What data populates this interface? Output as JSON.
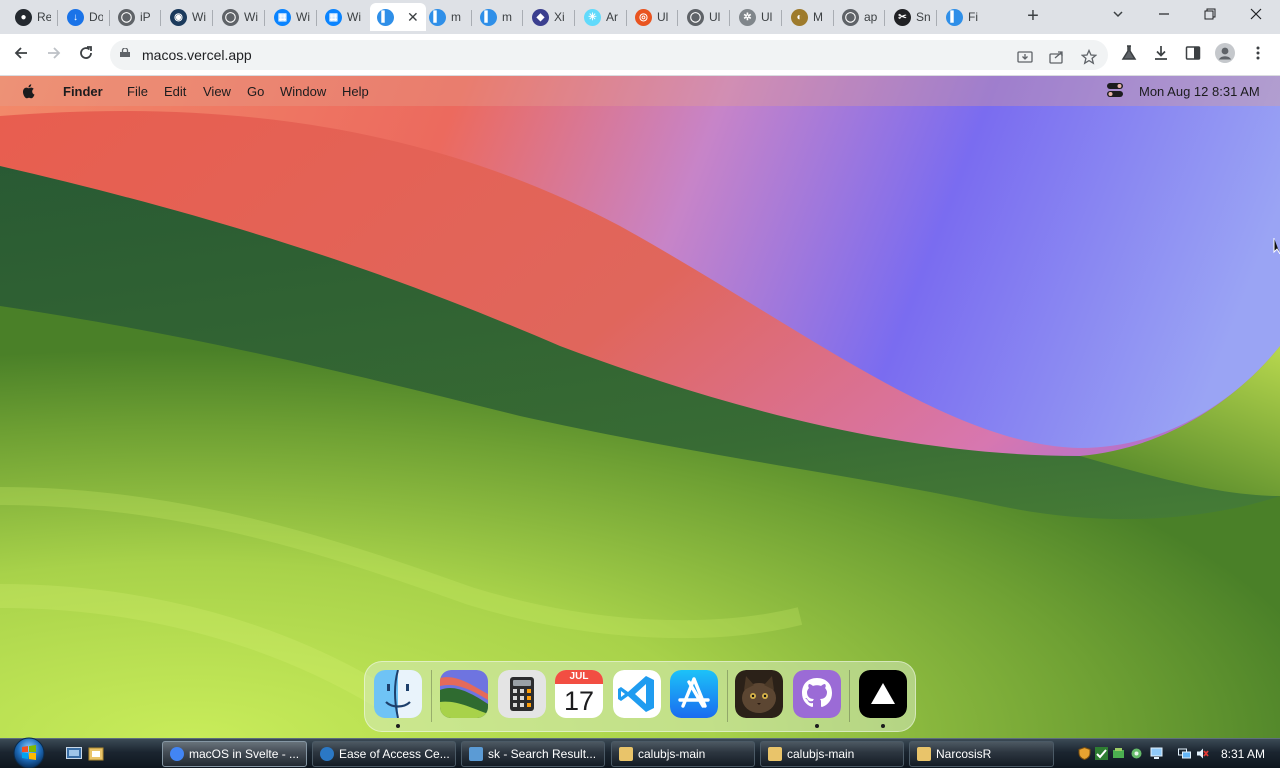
{
  "browser": {
    "tabs": [
      {
        "icon": "github-icon",
        "title": "Re"
      },
      {
        "icon": "download-icon",
        "title": "Do"
      },
      {
        "icon": "globe-icon",
        "title": "iP"
      },
      {
        "icon": "ai-app-icon",
        "title": "Wi"
      },
      {
        "icon": "globe-icon",
        "title": "Wi"
      },
      {
        "icon": "windows-logo-icon",
        "title": "Wi"
      },
      {
        "icon": "windows-logo-icon",
        "title": "Wi"
      },
      {
        "icon": "finder-icon",
        "title": "",
        "active": true
      },
      {
        "icon": "finder-icon",
        "title": "m"
      },
      {
        "icon": "finder-icon",
        "title": "m"
      },
      {
        "icon": "xi-icon",
        "title": "Xi"
      },
      {
        "icon": "react-icon",
        "title": "Ar"
      },
      {
        "icon": "ubuntu-icon",
        "title": "Ul"
      },
      {
        "icon": "globe-icon",
        "title": "Ul"
      },
      {
        "icon": "settings-icon",
        "title": "Ul"
      },
      {
        "icon": "m-app-icon",
        "title": "M"
      },
      {
        "icon": "globe-icon",
        "title": "ap"
      },
      {
        "icon": "snip-icon",
        "title": "Sn"
      },
      {
        "icon": "finder-icon",
        "title": "Fi"
      }
    ],
    "url": "macos.vercel.app"
  },
  "mac": {
    "app_name": "Finder",
    "menus": [
      "File",
      "Edit",
      "View",
      "Go",
      "Window",
      "Help"
    ],
    "clock": "Mon Aug 12  8:31 AM",
    "dock": {
      "apps": [
        {
          "name": "finder",
          "running": true
        },
        {
          "name": "wallpapers",
          "running": false
        },
        {
          "name": "calculator",
          "running": false
        },
        {
          "name": "calendar",
          "running": false
        },
        {
          "name": "vscode",
          "running": false
        },
        {
          "name": "app-store",
          "running": false
        },
        {
          "name": "purrfect-cat",
          "running": false
        },
        {
          "name": "github",
          "running": true
        },
        {
          "name": "vercel",
          "running": true
        }
      ],
      "calendar_month": "JUL",
      "calendar_day": "17"
    }
  },
  "taskbar": {
    "items": [
      {
        "label": "macOS in Svelte - ...",
        "icon": "chrome",
        "active": true
      },
      {
        "label": "Ease of Access Ce...",
        "icon": "ease-of-access",
        "active": false
      },
      {
        "label": "sk - Search Result...",
        "icon": "search",
        "active": false
      },
      {
        "label": "calubjs-main",
        "icon": "folder",
        "active": false
      },
      {
        "label": "calubjs-main",
        "icon": "folder",
        "active": false
      },
      {
        "label": "NarcosisR",
        "icon": "folder",
        "active": false
      }
    ],
    "clock": "8:31 AM"
  },
  "colors": {
    "tab_strip": "#dee1e6",
    "taskbar": "#1b2530",
    "wallpaper_green": "#2f6b30",
    "wallpaper_lime": "#a8d24a",
    "wallpaper_coral": "#ec6a5e",
    "wallpaper_violet": "#7a6cf0"
  }
}
